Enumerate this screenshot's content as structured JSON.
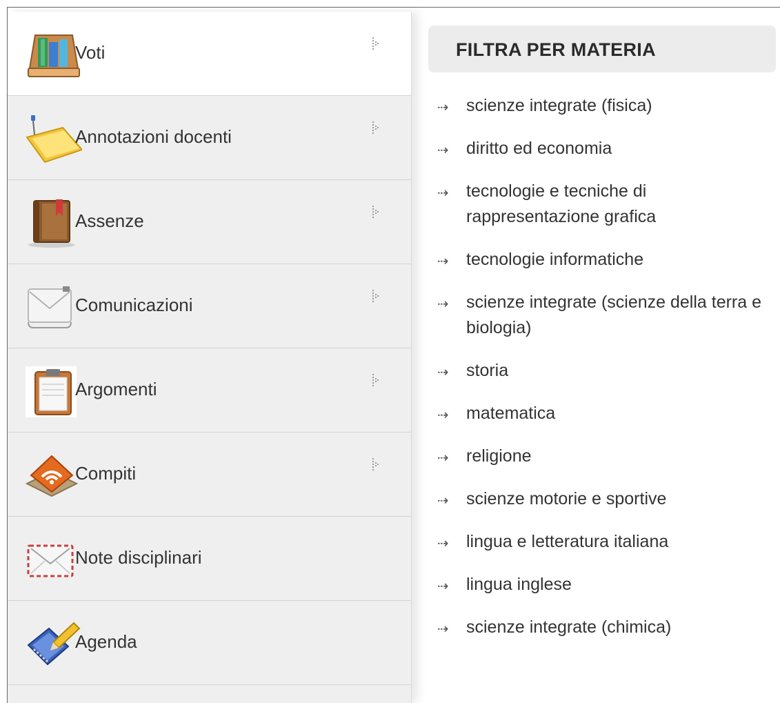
{
  "menu": [
    {
      "label": "Voti",
      "icon": "grades-books-icon",
      "has_submenu": true,
      "active": true
    },
    {
      "label": "Annotazioni docenti",
      "icon": "folder-pin-icon",
      "has_submenu": true,
      "active": false
    },
    {
      "label": "Assenze",
      "icon": "bookmark-book-icon",
      "has_submenu": true,
      "active": false
    },
    {
      "label": "Comunicazioni",
      "icon": "envelope-icon",
      "has_submenu": true,
      "active": false
    },
    {
      "label": "Argomenti",
      "icon": "clipboard-icon",
      "has_submenu": true,
      "active": false
    },
    {
      "label": "Compiti",
      "icon": "rss-feed-icon",
      "has_submenu": true,
      "active": false
    },
    {
      "label": "Note disciplinari",
      "icon": "airmail-envelope-icon",
      "has_submenu": false,
      "active": false
    },
    {
      "label": "Agenda",
      "icon": "pencil-notebook-icon",
      "has_submenu": false,
      "active": false
    }
  ],
  "filter": {
    "title": "FILTRA PER MATERIA",
    "subjects": [
      "scienze integrate (fisica)",
      "diritto ed economia",
      "tecnologie e tecniche di rappresentazione grafica",
      "tecnologie informatiche",
      "scienze integrate (scienze della terra e biologia)",
      "storia",
      "matematica",
      "religione",
      "scienze motorie e sportive",
      "lingua e letteratura italiana",
      "lingua inglese",
      "scienze integrate (chimica)"
    ]
  },
  "colors": {
    "sidebar_bg": "#efefef",
    "active_bg": "#ffffff",
    "title_bg": "#ececec",
    "text": "#333333"
  }
}
